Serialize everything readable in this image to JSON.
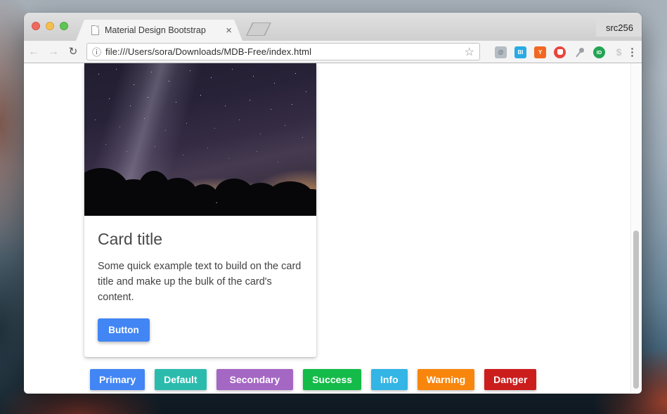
{
  "browser": {
    "window_label": "src256",
    "tab": {
      "title": "Material Design Bootstrap",
      "close_glyph": "×"
    },
    "nav": {
      "back_glyph": "←",
      "forward_glyph": "→",
      "reload_glyph": "↻"
    },
    "address_bar": {
      "info_glyph": "ⓘ",
      "url": "file:///Users/sora/Downloads/MDB-Free/index.html",
      "star_glyph": "☆"
    },
    "extensions": [
      {
        "name": "at-document",
        "kind": "square",
        "bg": "#b6bcc3",
        "fg": "#70767d",
        "glyph": "@"
      },
      {
        "name": "bi-blue",
        "kind": "square",
        "bg": "#29abe2",
        "fg": "#ffffff",
        "glyph": "BI"
      },
      {
        "name": "hacker-news-y",
        "kind": "square",
        "bg": "#f26822",
        "fg": "#ffffff",
        "glyph": "Y"
      },
      {
        "name": "stop-hand",
        "kind": "hand",
        "bg": "#e8453c",
        "fg": "#ffffff",
        "glyph": ""
      },
      {
        "name": "pushpin",
        "kind": "pin",
        "bg": "",
        "fg": "#9aa0a6",
        "glyph": ""
      },
      {
        "name": "id-green",
        "kind": "circle",
        "bg": "#23a455",
        "fg": "#ffffff",
        "glyph": "ID"
      },
      {
        "name": "dollar",
        "kind": "glyph",
        "bg": "",
        "fg": "#cbcbcb",
        "glyph": "$"
      }
    ],
    "menu_glyph": "⋮"
  },
  "page": {
    "card": {
      "title": "Card title",
      "text": "Some quick example text to build on the card title and make up the bulk of the card's content.",
      "button": {
        "label": "Button",
        "color": "#4285f4"
      }
    },
    "action_buttons": [
      {
        "name": "primary",
        "label": "Primary",
        "color": "#4285f4"
      },
      {
        "name": "default",
        "label": "Default",
        "color": "#2bbbad"
      },
      {
        "name": "secondary",
        "label": "Secondary",
        "color": "#a567c4"
      },
      {
        "name": "success",
        "label": "Success",
        "color": "#14bb49"
      },
      {
        "name": "info",
        "label": "Info",
        "color": "#33b5e5"
      },
      {
        "name": "warning",
        "label": "Warning",
        "color": "#f8860d"
      },
      {
        "name": "danger",
        "label": "Danger",
        "color": "#cc1d1d"
      }
    ]
  }
}
